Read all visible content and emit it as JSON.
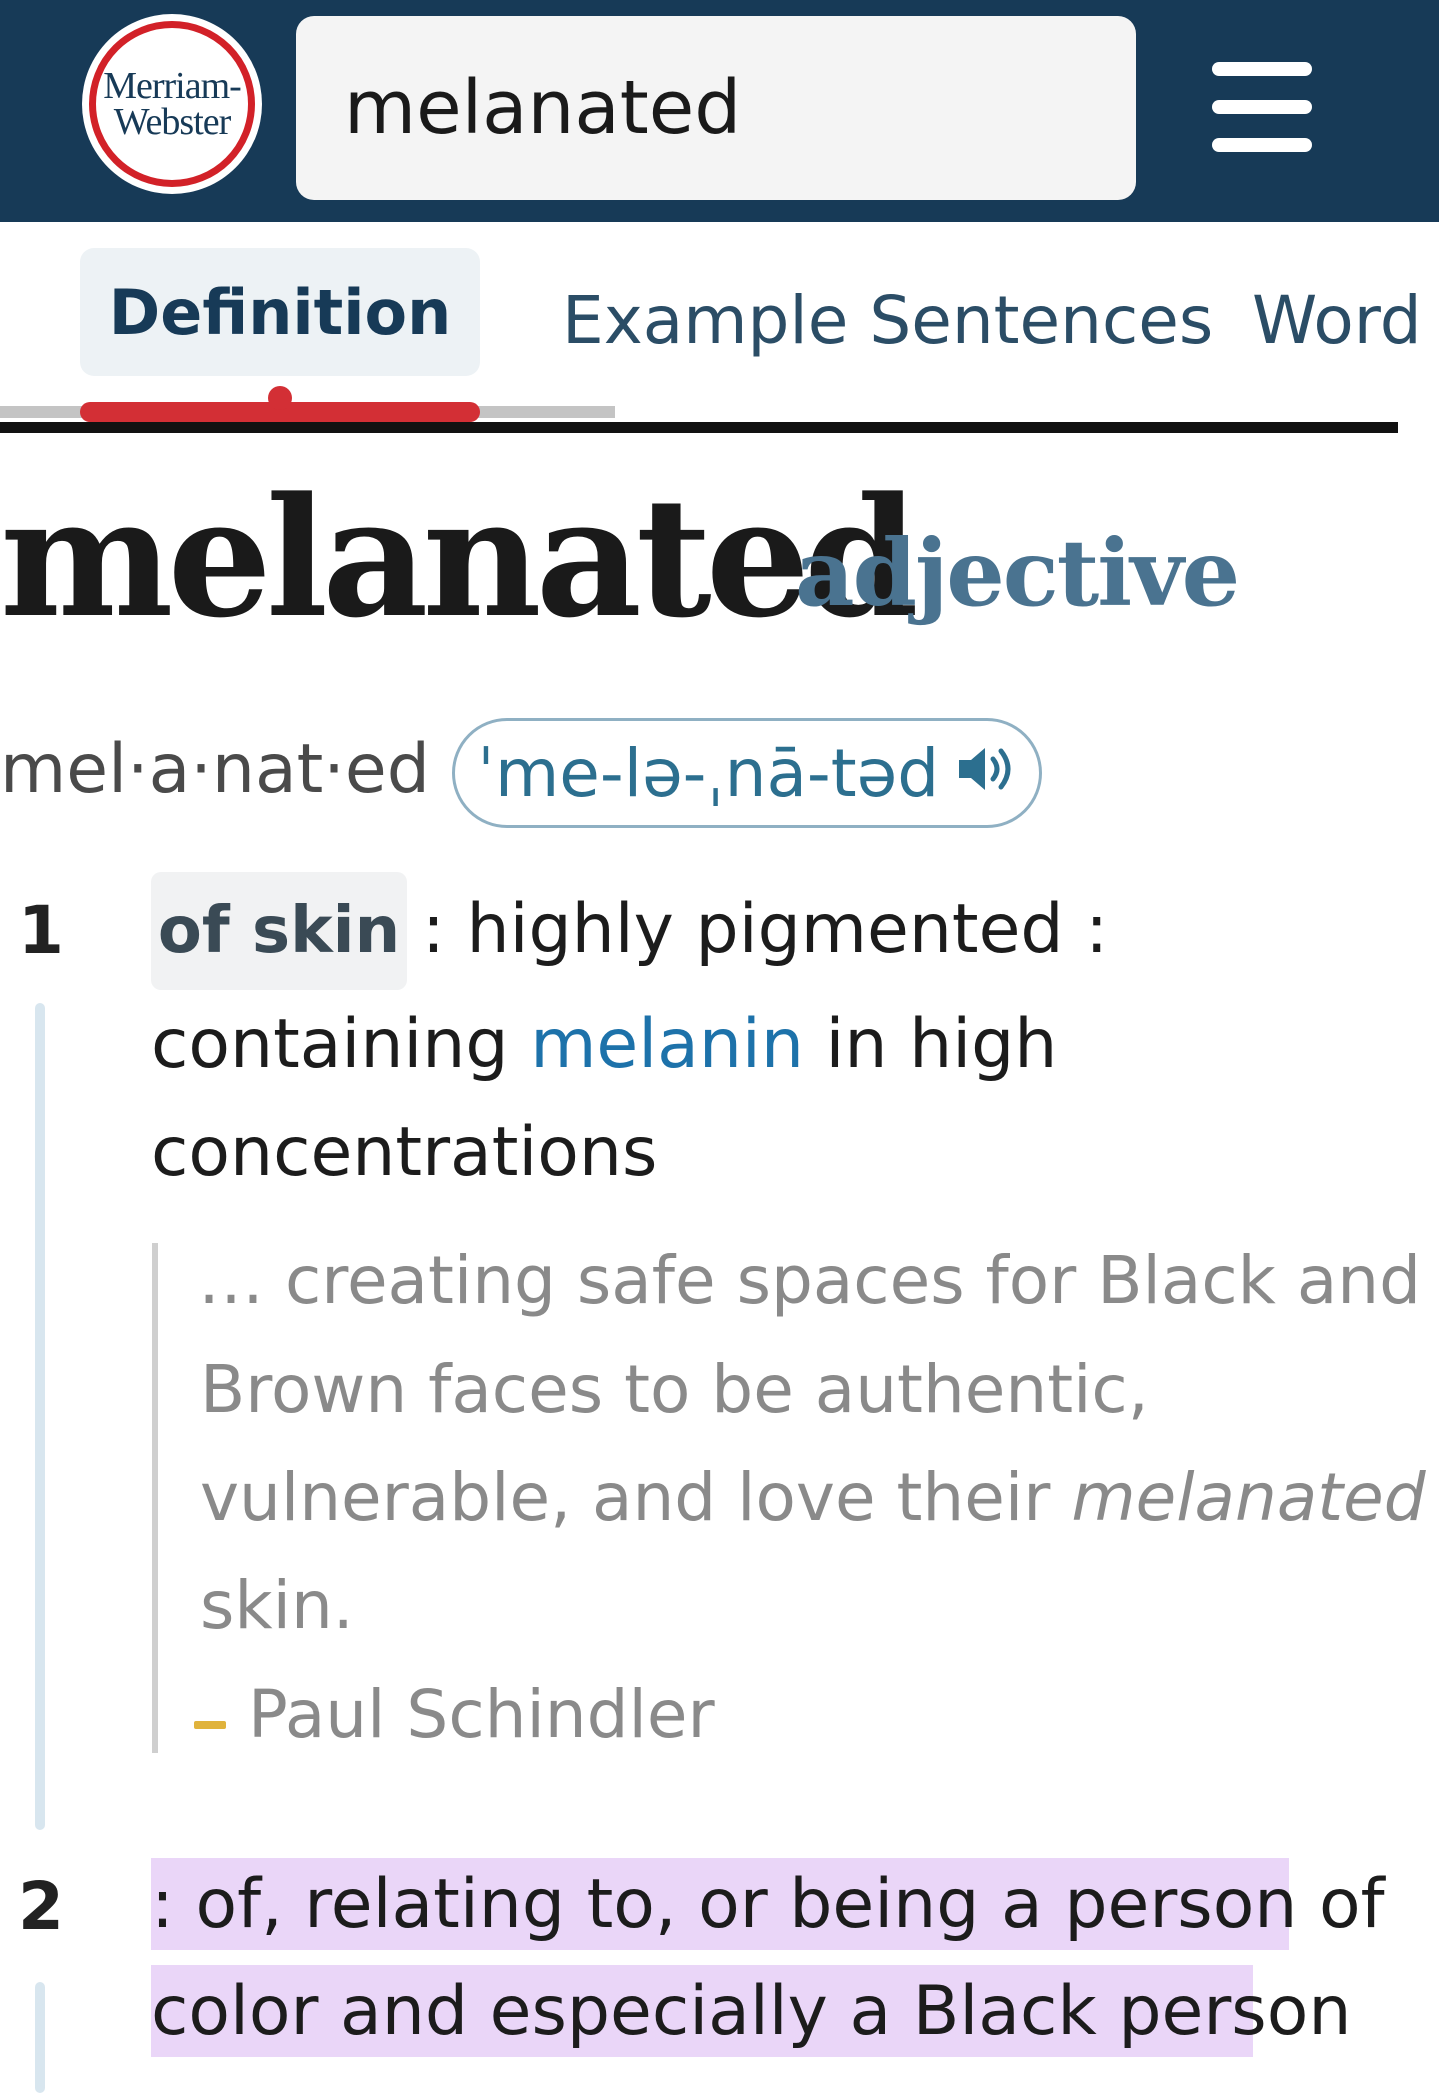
{
  "header": {
    "logo": {
      "line1": "Merriam-",
      "line2": "Webster"
    },
    "search": {
      "value": "melanated"
    },
    "colors": {
      "header_bg": "#173a57",
      "search_button": "#d71920"
    },
    "icons": {
      "search": "search-icon",
      "menu": "hamburger-menu-icon"
    }
  },
  "tabs": {
    "items": [
      {
        "label": "Definition",
        "active": true
      },
      {
        "label": "Example Sentences",
        "active": false
      },
      {
        "label": "Word",
        "active": false
      }
    ]
  },
  "entry": {
    "headword": "melanated",
    "part_of_speech": "adjective",
    "syllables": "mel·a·nat·ed",
    "pronunciation": "ˈme-lə-ˌnā-təd",
    "audio_icon": "speaker-icon",
    "senses": [
      {
        "number": "1",
        "label": "of skin",
        "line1_text": ": highly pigmented :",
        "line2_before": "containing ",
        "line2_link": "melanin",
        "line2_after": " in high",
        "line3": "concentrations",
        "quote": {
          "line1": "… creating safe spaces for Black and",
          "line2": "Brown faces to be authentic,",
          "line3_before": "vulnerable, and love their ",
          "line3_italic": "melanated",
          "line4": "skin.",
          "author": "Paul Schindler"
        }
      },
      {
        "number": "2",
        "line1": ": of, relating to, or being a person of",
        "line2": "color and especially a Black person",
        "highlight_color": "#ead6f8"
      }
    ]
  }
}
